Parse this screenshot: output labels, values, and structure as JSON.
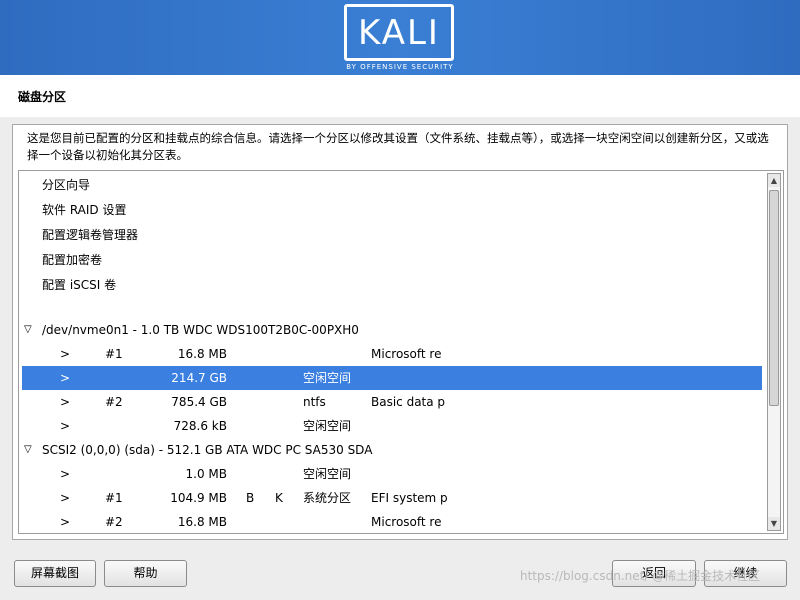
{
  "banner": {
    "logo_text": "KALI",
    "logo_subtitle": "BY OFFENSIVE SECURITY"
  },
  "page": {
    "title": "磁盘分区"
  },
  "description": "这是您目前已配置的分区和挂载点的综合信息。请选择一个分区以修改其设置（文件系统、挂载点等），或选择一块空闲空间以创建新分区，又或选择一个设备以初始化其分区表。",
  "menu_items": [
    {
      "label": "分区向导"
    },
    {
      "label": "软件 RAID 设置"
    },
    {
      "label": "配置逻辑卷管理器"
    },
    {
      "label": "配置加密卷"
    },
    {
      "label": "配置 iSCSI 卷"
    }
  ],
  "devices": [
    {
      "label": "/dev/nvme0n1 - 1.0 TB WDC WDS100T2B0C-00PXH0",
      "expander": "▽",
      "partitions": [
        {
          "arrow": ">",
          "num": "#1",
          "size": "16.8 MB",
          "flag1": "",
          "flag2": "",
          "fs": "",
          "name": "Microsoft re"
        },
        {
          "arrow": ">",
          "num": "",
          "size": "214.7 GB",
          "flag1": "",
          "flag2": "",
          "fs": "空闲空间",
          "name": "",
          "selected": true
        },
        {
          "arrow": ">",
          "num": "#2",
          "size": "785.4 GB",
          "flag1": "",
          "flag2": "",
          "fs": "ntfs",
          "name": "Basic data p"
        },
        {
          "arrow": ">",
          "num": "",
          "size": "728.6 kB",
          "flag1": "",
          "flag2": "",
          "fs": "空闲空间",
          "name": ""
        }
      ]
    },
    {
      "label": "SCSI2 (0,0,0) (sda) - 512.1 GB ATA WDC PC SA530 SDA",
      "expander": "▽",
      "partitions": [
        {
          "arrow": ">",
          "num": "",
          "size": "1.0 MB",
          "flag1": "",
          "flag2": "",
          "fs": "空闲空间",
          "name": ""
        },
        {
          "arrow": ">",
          "num": "#1",
          "size": "104.9 MB",
          "flag1": "B",
          "flag2": "K",
          "fs": "系统分区",
          "name": "EFI system p"
        },
        {
          "arrow": ">",
          "num": "#2",
          "size": "16.8 MB",
          "flag1": "",
          "flag2": "",
          "fs": "",
          "name": "Microsoft re"
        }
      ]
    }
  ],
  "scrollbar": {
    "up_icon": "▲",
    "down_icon": "▼"
  },
  "buttons": {
    "screenshot": "屏幕截图",
    "help": "帮助",
    "back": "返回",
    "continue": "继续"
  },
  "watermark": "https://blog.csdn.net/ @稀土掘金技术社区",
  "colors": {
    "banner": "#3577cc",
    "selection": "#3b80e0"
  }
}
